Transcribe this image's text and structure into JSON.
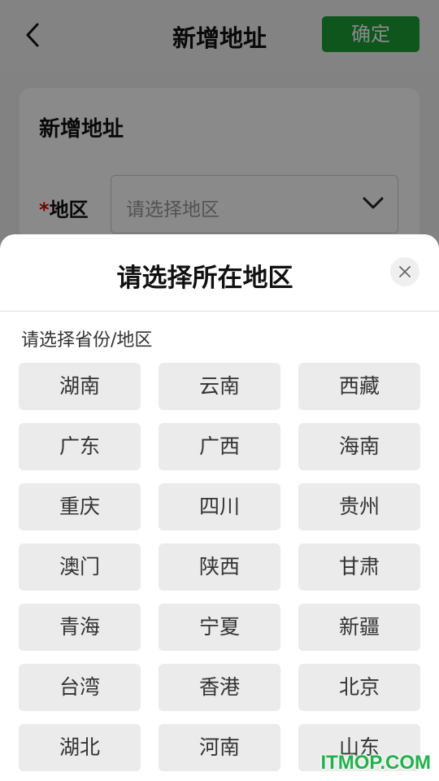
{
  "colors": {
    "accent_green": "#1aa035",
    "watermark_green": "#22b14c"
  },
  "header": {
    "back_icon": "chevron-left-icon",
    "title": "新增地址",
    "confirm_label": "确定"
  },
  "form": {
    "card_title": "新增地址",
    "required_mark": "*",
    "region_label": "地区",
    "region_placeholder": "请选择地区",
    "dropdown_icon": "chevron-down-icon"
  },
  "sheet": {
    "title": "请选择所在地区",
    "close_icon": "close-icon",
    "section_label": "请选择省份/地区",
    "regions": [
      "湖南",
      "云南",
      "西藏",
      "广东",
      "广西",
      "海南",
      "重庆",
      "四川",
      "贵州",
      "澳门",
      "陕西",
      "甘肃",
      "青海",
      "宁夏",
      "新疆",
      "台湾",
      "香港",
      "北京",
      "湖北",
      "河南",
      "山东"
    ]
  },
  "watermark": "ITMOP.COM"
}
